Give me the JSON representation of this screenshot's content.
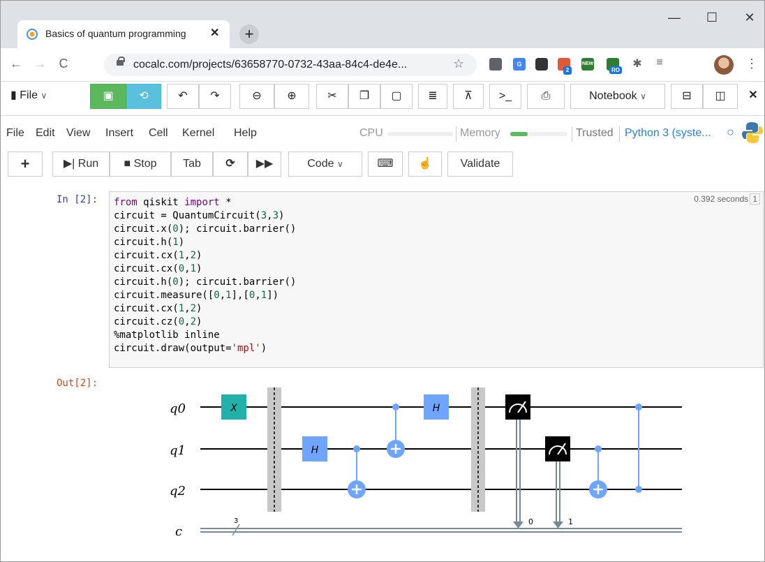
{
  "browser": {
    "tab_title": "Basics of quantum programming",
    "tab_close": "✕",
    "new_tab": "+",
    "url": "cocalc.com/projects/63658770-0732-43aa-84c4-de4e...",
    "window_controls": {
      "minimize": "—",
      "maximize": "☐",
      "close": "✕"
    },
    "ext_badges": {
      "ext2": "2",
      "new": "NEW",
      "ro": "RO"
    }
  },
  "cocalc_toolbar": {
    "file_label": "File",
    "notebook_label": "Notebook"
  },
  "menu": {
    "items": [
      "File",
      "Edit",
      "View",
      "Insert",
      "Cell",
      "Kernel",
      "Help"
    ],
    "cpu_label": "CPU",
    "memory_label": "Memory",
    "memory_level": 0.3,
    "trusted": "Trusted",
    "kernel": "Python 3 (syste..."
  },
  "cell_toolbar": {
    "run": "Run",
    "stop": "Stop",
    "tab": "Tab",
    "cell_type": "Code",
    "validate": "Validate"
  },
  "cell": {
    "in_prompt": "In [2]:",
    "out_prompt": "Out[2]:",
    "timing": "0.392 seconds",
    "exec_count": "1"
  },
  "circuit": {
    "qubits": [
      "q0",
      "q1",
      "q2"
    ],
    "classical": "c",
    "classical_width": "3",
    "measure_bits": [
      "0",
      "1"
    ],
    "gate_labels": {
      "x": "X",
      "h": "H"
    },
    "colors": {
      "x_gate": "#20b2aa",
      "h_gate": "#6fa4ff",
      "cx": "#6fa4ff",
      "barrier": "#c8c8c8",
      "measure": "#000000",
      "classical": "#778899"
    }
  }
}
